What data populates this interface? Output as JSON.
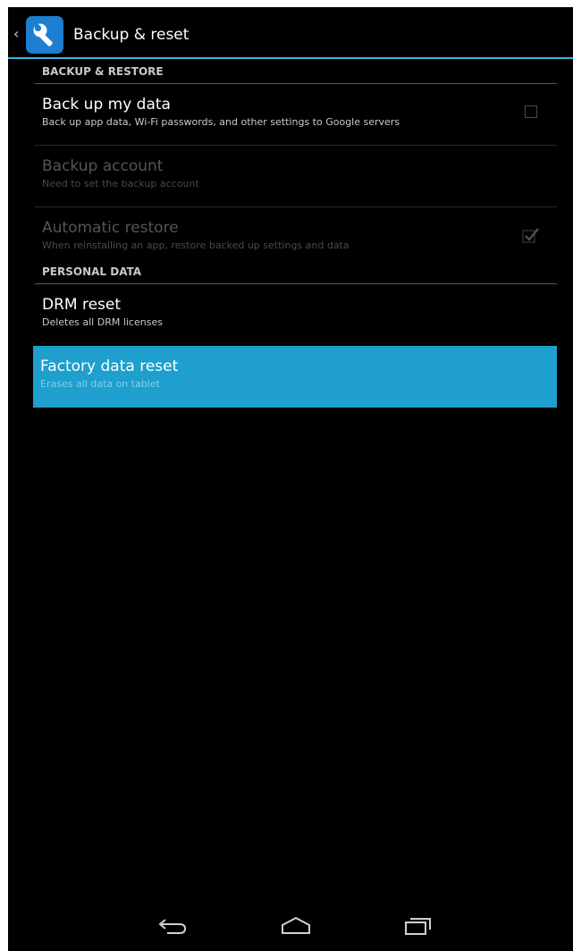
{
  "action_bar": {
    "title": "Backup & reset",
    "up_icon": "chevron-left-icon",
    "app_icon": "wrench-icon",
    "accent_color": "#33b5e5"
  },
  "sections": {
    "backup": {
      "header": "BACKUP & RESTORE",
      "items": [
        {
          "title": "Back up my data",
          "summary": "Back up app data, Wi-Fi passwords, and other settings to Google servers",
          "enabled": true,
          "checked": false
        },
        {
          "title": "Backup account",
          "summary": "Need to set the backup account",
          "enabled": false
        },
        {
          "title": "Automatic restore",
          "summary": "When reinstalling an app, restore backed up settings and data",
          "enabled": false,
          "checked": true
        }
      ]
    },
    "personal": {
      "header": "PERSONAL DATA",
      "items": [
        {
          "title": "DRM reset",
          "summary": "Deletes all DRM licenses",
          "enabled": true
        },
        {
          "title": "Factory data reset",
          "summary": "Erases all data on tablet",
          "enabled": true,
          "selected": true,
          "highlight_color": "#1e9fce"
        }
      ]
    }
  },
  "nav_bar": {
    "back_icon": "back-arrow-icon",
    "home_icon": "home-icon",
    "recents_icon": "recent-apps-icon"
  }
}
